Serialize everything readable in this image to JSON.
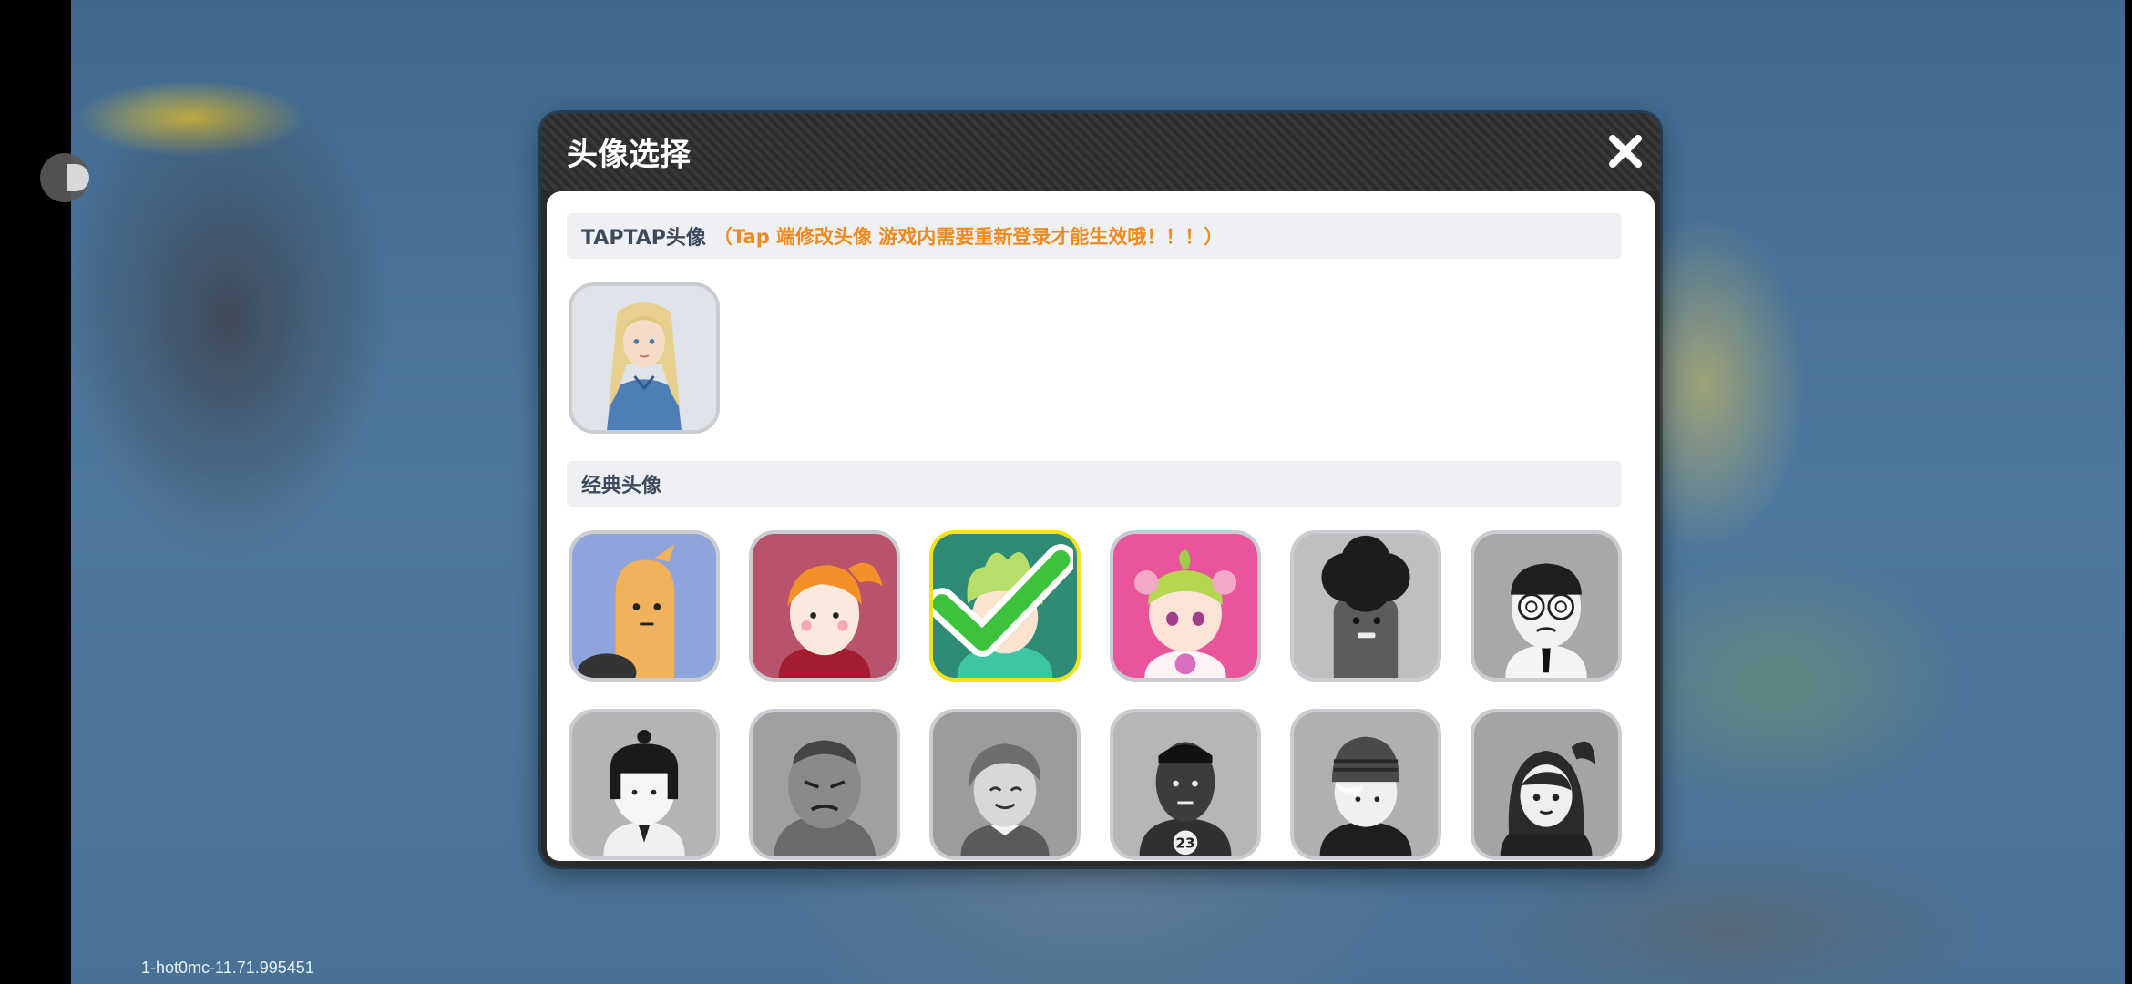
{
  "app": {
    "version_text": "1-hot0mc-11.71.995451"
  },
  "dialog": {
    "title": "头像选择",
    "close_icon": "close-icon"
  },
  "taptap_section": {
    "label": "TAPTAP头像",
    "note": "（Tap 端修改头像 游戏内需要重新登录才能生效哦！！！）",
    "avatars": [
      {
        "name": "taptap-avatar-blonde-woman",
        "selected": false
      }
    ]
  },
  "classic_section": {
    "label": "经典头像",
    "avatars": [
      {
        "name": "avatar-orange-bean",
        "selected": false,
        "unlocked": true
      },
      {
        "name": "avatar-ponytail-girl",
        "selected": false,
        "unlocked": true
      },
      {
        "name": "avatar-green-hair-boy",
        "selected": true,
        "unlocked": true
      },
      {
        "name": "avatar-pink-bun-girl",
        "selected": false,
        "unlocked": true
      },
      {
        "name": "avatar-afro",
        "selected": false,
        "unlocked": false
      },
      {
        "name": "avatar-glasses-suit",
        "selected": false,
        "unlocked": false
      },
      {
        "name": "avatar-bob-hair-girl",
        "selected": false,
        "unlocked": false
      },
      {
        "name": "avatar-bald-brawler",
        "selected": false,
        "unlocked": false
      },
      {
        "name": "avatar-smiling-lady",
        "selected": false,
        "unlocked": false
      },
      {
        "name": "avatar-basketball-23",
        "selected": false,
        "unlocked": false
      },
      {
        "name": "avatar-beanie-kid",
        "selected": false,
        "unlocked": false
      },
      {
        "name": "avatar-long-hair-girl",
        "selected": false,
        "unlocked": false
      }
    ]
  },
  "colors": {
    "selected_border": "#f2e21a",
    "note_orange": "#f08a1c",
    "check_green": "#3cc23c"
  }
}
